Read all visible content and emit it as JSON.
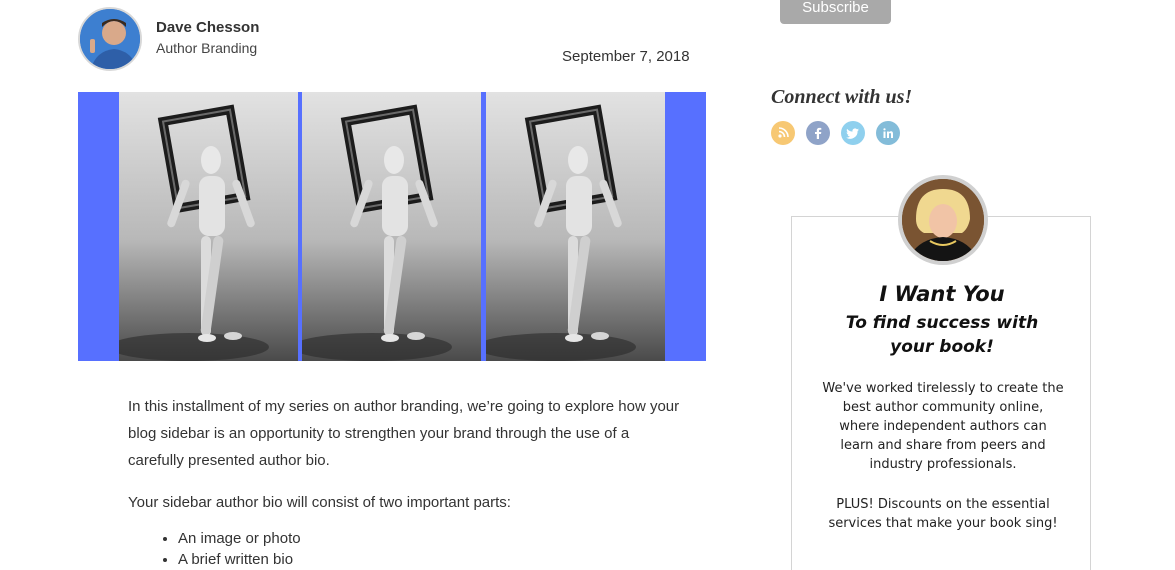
{
  "author": {
    "name": "Dave Chesson",
    "category": "Author Branding",
    "date": "September 7, 2018"
  },
  "article": {
    "paragraph1": "In this installment of my series on author branding, we’re going to explore how your blog sidebar is an opportunity to strengthen your brand through the use of a carefully presented author bio.",
    "paragraph2": "Your sidebar author bio will consist of two important parts:",
    "list": [
      "An image or photo",
      "A brief written bio"
    ]
  },
  "sidebar": {
    "subscribe_label": "Subscribe",
    "connect_title": "Connect with us!",
    "social_icons": [
      {
        "name": "rss-icon",
        "color": "#f7c873"
      },
      {
        "name": "facebook-icon",
        "color": "#8fa3c8"
      },
      {
        "name": "twitter-icon",
        "color": "#8fd0ee"
      },
      {
        "name": "linkedin-icon",
        "color": "#83bcd9"
      }
    ],
    "promo": {
      "heading": "I Want You",
      "subheading_1": "To find success with",
      "subheading_2": "your book!",
      "body_lines": [
        "We've worked tirelessly to create the",
        "best author community online,",
        "where independent authors can",
        "learn and share from peers and",
        "industry professionals."
      ],
      "plus_lines": [
        "PLUS! Discounts on the essential",
        "services that make your book sing!"
      ]
    }
  },
  "colors": {
    "featured_background": "#5770ff",
    "subscribe_button": "#a9a9a9"
  }
}
